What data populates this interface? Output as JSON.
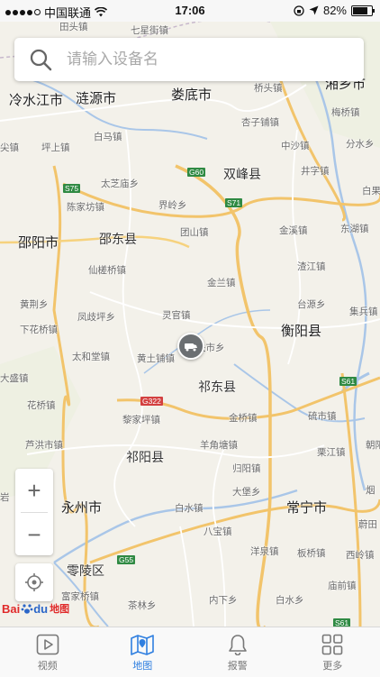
{
  "status_bar": {
    "carrier": "中国联通",
    "time": "17:06",
    "battery": "82%"
  },
  "search": {
    "placeholder": "请输入设备名"
  },
  "map": {
    "cities": [
      {
        "name": "娄底市"
      },
      {
        "name": "邵阳市"
      },
      {
        "name": "衡阳县"
      },
      {
        "name": "永州市"
      },
      {
        "name": "常宁市"
      },
      {
        "name": "冷水江市"
      },
      {
        "name": "涟源市"
      },
      {
        "name": "湘乡市"
      }
    ],
    "counties": [
      {
        "name": "双峰县"
      },
      {
        "name": "邵东县"
      },
      {
        "name": "祁东县"
      },
      {
        "name": "祁阳县"
      },
      {
        "name": "零陵区"
      }
    ],
    "towns": [
      "田头镇",
      "七星街镇",
      "桥头镇",
      "杏子铺镇",
      "梅桥镇",
      "中沙镇",
      "分水乡",
      "坪上镇",
      "白马镇",
      "井字镇",
      "太芝庙乡",
      "界岭乡",
      "金溪镇",
      "东湖镇",
      "陈家坊镇",
      "团山镇",
      "白果",
      "渣江镇",
      "仙槎桥镇",
      "金兰镇",
      "台源乡",
      "黄荆乡",
      "凤歧坪乡",
      "灵官镇",
      "集兵镇",
      "下花桥镇",
      "太和堂镇",
      "关市乡",
      "黄土铺镇",
      "大盛镇",
      "花桥镇",
      "黎家坪镇",
      "金桥镇",
      "硫市镇",
      "芦洪市镇",
      "羊角塘镇",
      "栗江镇",
      "朝阳",
      "归阳镇",
      "大堡乡",
      "岩",
      "白水镇",
      "八宝镇",
      "烟",
      "蔚田",
      "洋泉镇",
      "板桥镇",
      "西岭镇",
      "富家桥镇",
      "茶林乡",
      "内下乡",
      "白水乡",
      "庙前镇",
      "尖镇"
    ],
    "roads": [
      "G60",
      "S75",
      "S71",
      "G322",
      "S61",
      "G55",
      "S61"
    ]
  },
  "controls": {
    "zoom_in": "+",
    "zoom_out": "−"
  },
  "logo": {
    "bai": "Bai",
    "du": "du",
    "ditu": "地图"
  },
  "tabs": [
    {
      "label": "视频",
      "icon": "video-icon",
      "active": false
    },
    {
      "label": "地图",
      "icon": "map-icon",
      "active": true
    },
    {
      "label": "报警",
      "icon": "bell-icon",
      "active": false
    },
    {
      "label": "更多",
      "icon": "grid-icon",
      "active": false
    }
  ],
  "colors": {
    "accent": "#2f7fe0",
    "road_major": "#f6d27e",
    "water": "#a9c6e8",
    "land": "#f3f1ea"
  }
}
